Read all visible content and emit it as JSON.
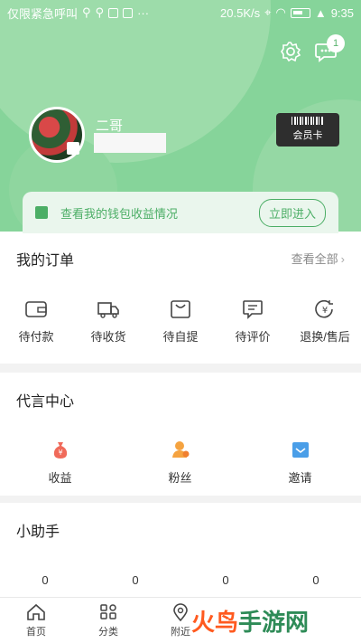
{
  "status_bar": {
    "left_text": "仅限紧急呼叫",
    "speed": "20.5K/s",
    "time": "9:35"
  },
  "header": {
    "message_badge": "1",
    "username": "二哥",
    "member_card_label": "会员卡",
    "wallet_text": "查看我的钱包收益情况",
    "wallet_button": "立即进入"
  },
  "orders": {
    "title": "我的订单",
    "view_all": "查看全部",
    "items": [
      {
        "label": "待付款",
        "icon": "wallet-icon"
      },
      {
        "label": "待收货",
        "icon": "truck-icon"
      },
      {
        "label": "待自提",
        "icon": "bag-icon"
      },
      {
        "label": "待评价",
        "icon": "comment-icon"
      },
      {
        "label": "退换/售后",
        "icon": "refund-icon"
      }
    ]
  },
  "agent": {
    "title": "代言中心",
    "items": [
      {
        "label": "收益",
        "icon": "money-bag-icon",
        "color": "#f06a5a"
      },
      {
        "label": "粉丝",
        "icon": "fans-icon",
        "color": "#f5a340"
      },
      {
        "label": "邀请",
        "icon": "invite-icon",
        "color": "#4a9ee8"
      }
    ]
  },
  "helper": {
    "title": "小助手",
    "values": [
      "0",
      "0",
      "0",
      "0"
    ]
  },
  "tabbar": {
    "items": [
      {
        "label": "首页",
        "icon": "home-icon"
      },
      {
        "label": "分类",
        "icon": "category-icon"
      },
      {
        "label": "附近",
        "icon": "location-icon"
      }
    ]
  },
  "watermark": {
    "fire": "火鸟",
    "rest": "手游网"
  },
  "colors": {
    "brand_green": "#86d49a",
    "accent_green": "#4cae66"
  }
}
